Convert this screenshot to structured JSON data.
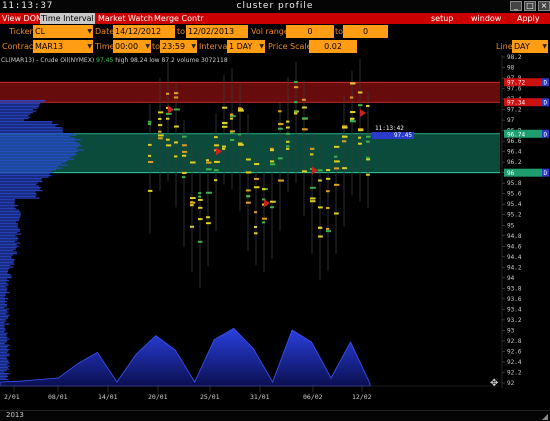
{
  "window": {
    "clock": "11:13:37",
    "title": "cluster profile",
    "btn_minimize": "_",
    "btn_restore": "□",
    "btn_close": "×"
  },
  "menubar": {
    "items": [
      "View DOM",
      "Time Interval",
      "Market Watch",
      "Merge Contr"
    ],
    "right_items": [
      "setup",
      "window",
      "Apply"
    ]
  },
  "params": {
    "ticker_label": "Ticker",
    "ticker_value": "CL",
    "date_label": "Date",
    "date_from": "14/12/2012",
    "to_label": "to",
    "date_to": "12/02/2013",
    "vol_range_label": "Vol range",
    "vol_from": "0",
    "vol_to_label": "to",
    "vol_to": "0",
    "contract_label": "Contract",
    "contract_value": "MAR13",
    "time_label": "Time",
    "time_from": "00:00",
    "time_to_label": "to",
    "time_to": "23:59",
    "interval_label": "Interval",
    "interval_value": "1 DAY",
    "price_scale_label": "Price Scale",
    "price_scale_value": "0.02",
    "line_label": "Line",
    "line_value": "DAY"
  },
  "info": {
    "symbol": "CL(MAR13)",
    "sep": "-",
    "name": "Crude Oil(NYMEX)",
    "last": "97.45",
    "high_label": "high",
    "high": "98.24",
    "low_label": "low",
    "low": "87.2",
    "volume_label": "volume",
    "volume": "3072118"
  },
  "price_axis": {
    "ticks": [
      "98.2",
      "98",
      "97.8",
      "97.6",
      "97.4",
      "97.2",
      "97",
      "96.8",
      "96.6",
      "96.4",
      "96.2",
      "96",
      "95.8",
      "95.6",
      "95.4",
      "95.2",
      "95",
      "94.8",
      "94.6",
      "94.4",
      "94.2",
      "94",
      "93.8",
      "93.6",
      "93.4",
      "93.2",
      "93",
      "92.8",
      "92.6",
      "92.4",
      "92.2",
      "92"
    ],
    "tags": [
      {
        "price": "97.72",
        "color": "#cc1111",
        "tag": "D"
      },
      {
        "price": "97.34",
        "color": "#cc1111",
        "tag": "D"
      },
      {
        "price": "96.74",
        "color": "#1e9e6e",
        "tag": "D"
      },
      {
        "price": "96",
        "color": "#1e9e6e",
        "tag": "D"
      }
    ],
    "current_time": "11:13:42",
    "current_price": "97.45"
  },
  "date_axis": {
    "labels": [
      "2/01",
      "08/01",
      "14/01",
      "20/01",
      "25/01",
      "31/01",
      "06/02",
      "12/02"
    ],
    "year": "2013"
  },
  "zones": {
    "red_zone": {
      "high": 97.72,
      "low": 97.34,
      "color": "#8a1010"
    },
    "green_zone": {
      "high": 96.74,
      "low": 96.0,
      "color": "#0d5e4a"
    }
  },
  "chart_data": {
    "type": "cluster-profile",
    "price_range": [
      92.0,
      98.2
    ],
    "daily_volume_area": [
      0.05,
      0.06,
      0.08,
      0.1,
      0.28,
      0.42,
      0.05,
      0.4,
      0.63,
      0.45,
      0.05,
      0.58,
      0.72,
      0.47,
      0.05,
      0.7,
      0.55,
      0.1,
      0.55,
      0.03
    ],
    "colors": {
      "volume_fill": "#1c2fb0",
      "profile": "#2a4bd8",
      "up": "#e0d020",
      "down": "#cc2020",
      "neutral": "#3bb24a"
    }
  }
}
